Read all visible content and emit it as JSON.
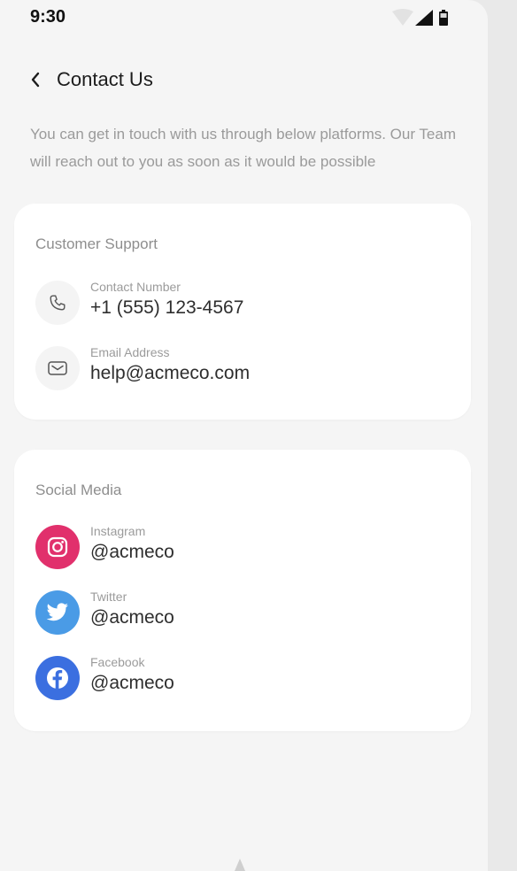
{
  "status_bar": {
    "time": "9:30"
  },
  "header": {
    "title": "Contact Us"
  },
  "intro_text": "You can get in touch with us through below platforms. Our Team will reach out to you as soon as it would be possible",
  "customer_support": {
    "title": "Customer Support",
    "contact_label": "Contact Number",
    "contact_value": "+1 (555) 123-4567",
    "email_label": "Email Address",
    "email_value": "help@acmeco.com"
  },
  "social_media": {
    "title": "Social Media",
    "items": [
      {
        "label": "Instagram",
        "value": "@acmeco",
        "icon": "instagram-icon",
        "color": "#e1306c"
      },
      {
        "label": "Twitter",
        "value": "@acmeco",
        "icon": "twitter-icon",
        "color": "#4a9be6"
      },
      {
        "label": "Facebook",
        "value": "@acmeco",
        "icon": "facebook-icon",
        "color": "#3b6fe0"
      }
    ]
  }
}
